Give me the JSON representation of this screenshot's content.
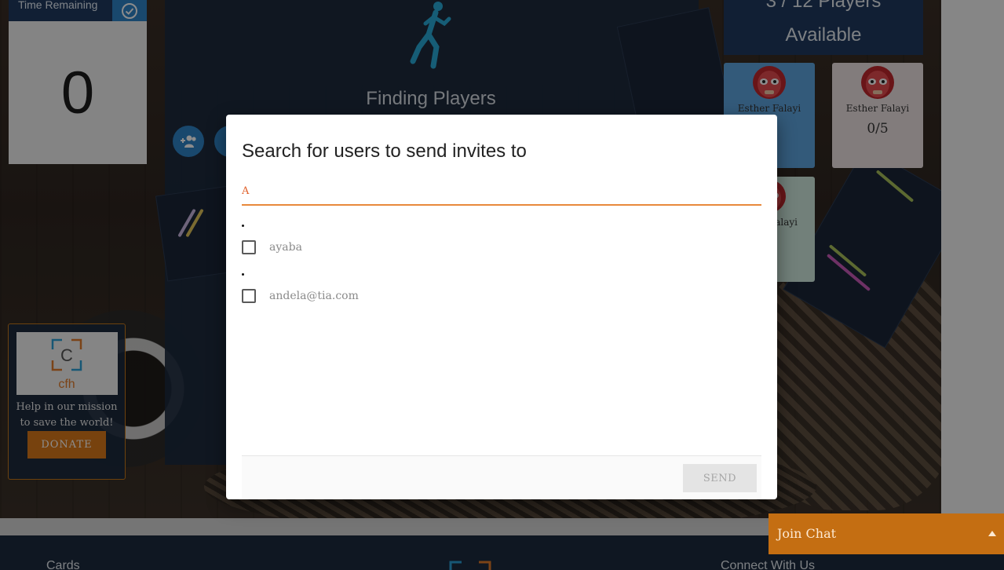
{
  "timer": {
    "label": "Time Remaining",
    "value": "0"
  },
  "game": {
    "status": "Finding Players"
  },
  "players": {
    "count_label": "3 / 12 Players",
    "available_label": "Available",
    "cards": [
      {
        "name": "Esther Falayi",
        "score": "",
        "color": "#5ea4de"
      },
      {
        "name": "Esther Falayi",
        "score": "0/5",
        "color": "#ede2e2"
      },
      {
        "name": "alayi",
        "score": "",
        "color": "#cfe9df"
      }
    ]
  },
  "donate": {
    "logo_text": "cfh",
    "logo_letter": "C",
    "message": "Help in our mission to save the world!",
    "button_label": "DONATE"
  },
  "modal": {
    "title": "Search for users to send invites to",
    "search_value": "A",
    "results": [
      {
        "label": "ayaba",
        "checked": false
      },
      {
        "label": "andela@tia.com",
        "checked": false
      }
    ],
    "send_label": "SEND"
  },
  "chat": {
    "label": "Join Chat"
  },
  "footer": {
    "cards_label": "Cards",
    "connect_label": "Connect With Us"
  },
  "colors": {
    "accent_orange": "#d9781a",
    "primary_blue": "#2f83c7",
    "navy": "#1c2a3f"
  }
}
